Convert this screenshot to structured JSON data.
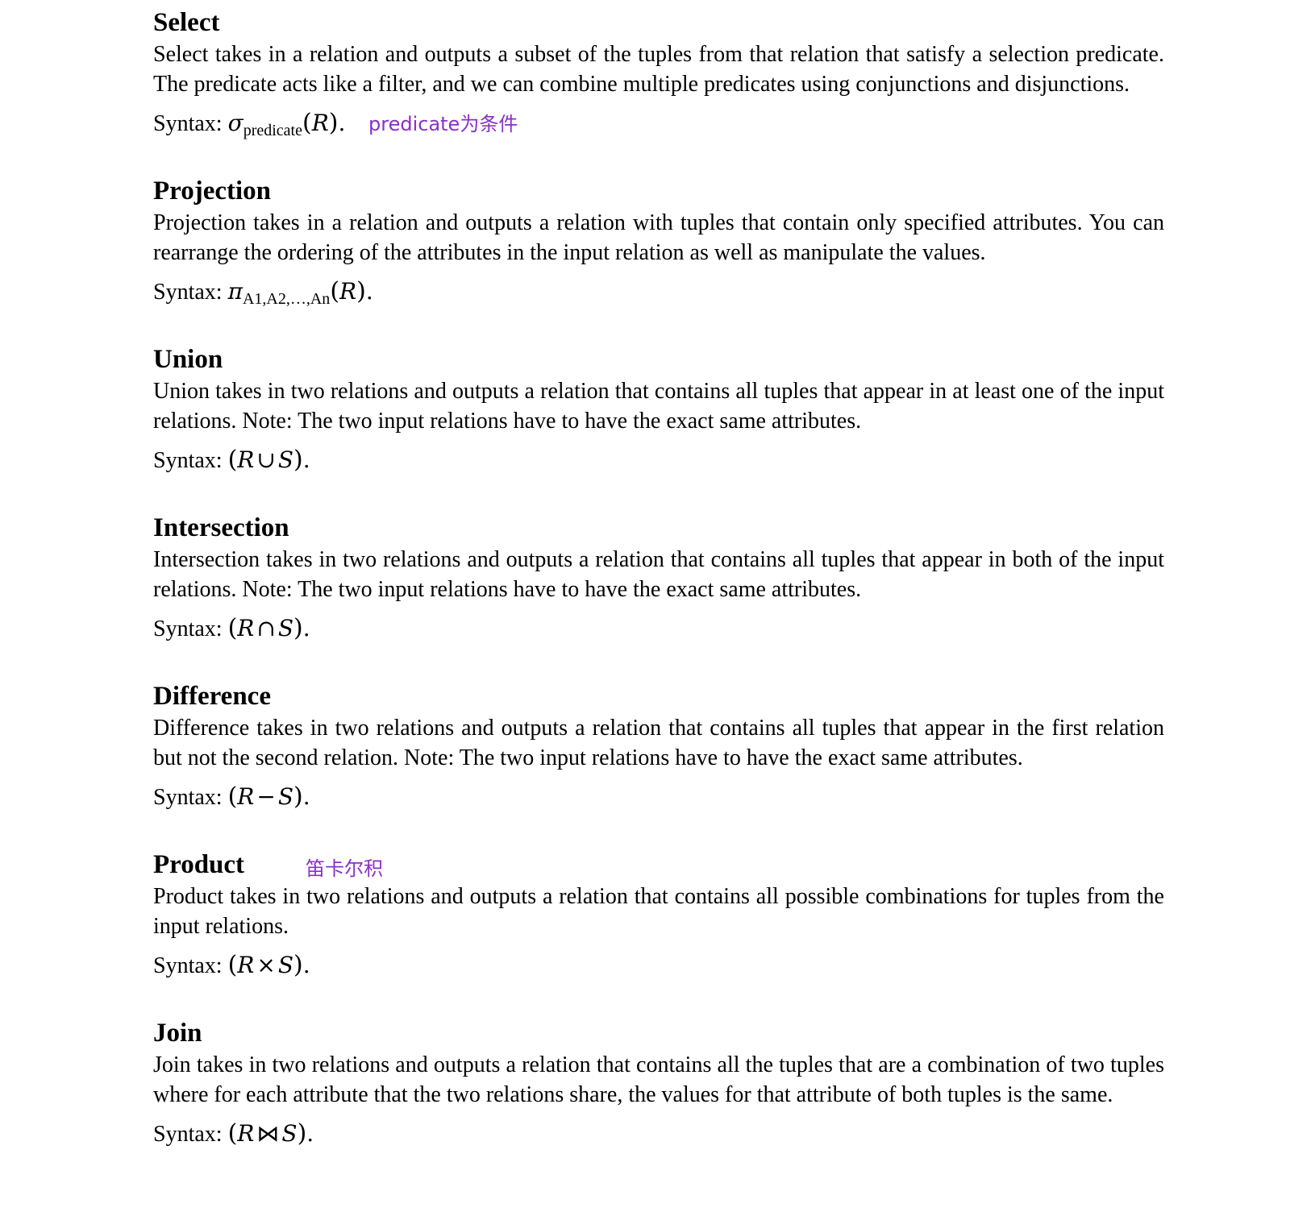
{
  "sections": [
    {
      "title": "Select",
      "body": "Select takes in a relation and outputs a subset of the tuples from that relation that satisfy a selection predicate. The predicate acts like a filter, and we can combine multiple predicates using conjunctions and disjunctions.",
      "syntax_label": "Syntax:",
      "symbol": "σ",
      "subscript": "predicate",
      "annotation": "predicate为条件"
    },
    {
      "title": "Projection",
      "body": "Projection takes in a relation and outputs a relation with tuples that contain only specified attributes. You can rearrange the ordering of the attributes in the input relation as well as manipulate the values.",
      "syntax_label": "Syntax:",
      "symbol": "π",
      "subscript": "A1,A2,…,An"
    },
    {
      "title": "Union",
      "body": "Union takes in two relations and outputs a relation that contains all tuples that appear in at least one of the input relations. Note: The two input relations have to have the exact same attributes.",
      "syntax_label": "Syntax:",
      "operator": "∪"
    },
    {
      "title": "Intersection",
      "body": "Intersection takes in two relations and outputs a relation that contains all tuples that appear in both of the input relations. Note: The two input relations have to have the exact same attributes.",
      "syntax_label": "Syntax:",
      "operator": "∩"
    },
    {
      "title": "Difference",
      "body": "Difference takes in two relations and outputs a relation that contains all tuples that appear in the first relation but not the second relation. Note: The two input relations have to have the exact same attributes.",
      "syntax_label": "Syntax:",
      "operator": "−"
    },
    {
      "title": "Product",
      "annotation": "笛卡尔积",
      "body": "Product takes in two relations and outputs a relation that contains all possible combinations for tuples from the input relations.",
      "syntax_label": "Syntax:",
      "operator": "×"
    },
    {
      "title": "Join",
      "body": "Join takes in two relations and outputs a relation that contains all the tuples that are a combination of two tuples where for each attribute that the two relations share, the values for that attribute of both tuples is the same.",
      "syntax_label": "Syntax:",
      "operator": "⋈"
    }
  ],
  "math": {
    "relation_r": "R",
    "relation_s": "S",
    "open_paren": "(",
    "close_paren": ")",
    "period": "."
  },
  "colors": {
    "text": "#000000",
    "annotation": "#8a2fc8",
    "background": "#ffffff"
  }
}
